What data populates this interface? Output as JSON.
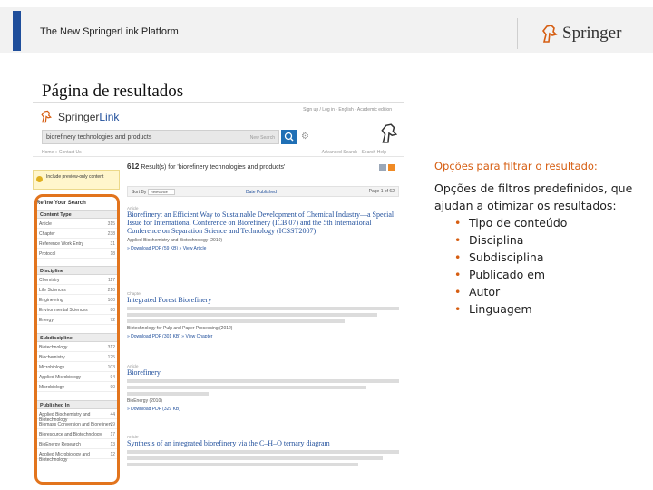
{
  "header": {
    "title": "The New SpringerLink Platform",
    "brand": "Springer",
    "accent_color": "#1f4e9b"
  },
  "page_heading": "Página de resultados",
  "screenshot": {
    "logo": {
      "part1": "Springer",
      "part2": "Link"
    },
    "search_query": "biorefinery technologies and products",
    "search_hint": "New Search",
    "top_links": "Sign up / Log in · English · Academic edition",
    "breadcrumb": "Home » Contact Us",
    "breadcrumb_right": "Advanced Search · Search Help",
    "include_banner": "Include preview-only content",
    "refine_title": "Refine Your Search",
    "results_count": "612",
    "results_text": "Result(s) for 'biorefinery technologies and products'",
    "sort_label": "Sort By",
    "sort_value": "Relevance",
    "date_published": "Date Published",
    "page_label": "Page  1  of 62",
    "facets": [
      {
        "title": "Content Type",
        "items": [
          {
            "label": "Article",
            "count": "315"
          },
          {
            "label": "Chapter",
            "count": "238"
          },
          {
            "label": "Reference Work Entry",
            "count": "31"
          },
          {
            "label": "Protocol",
            "count": "18"
          }
        ]
      },
      {
        "title": "Discipline",
        "items": [
          {
            "label": "Chemistry",
            "count": "117"
          },
          {
            "label": "Life Sciences",
            "count": "210"
          },
          {
            "label": "Engineering",
            "count": "100"
          },
          {
            "label": "Environmental Sciences",
            "count": "80"
          },
          {
            "label": "Energy",
            "count": "72"
          }
        ]
      },
      {
        "title": "Subdiscipline",
        "items": [
          {
            "label": "Biotechnology",
            "count": "312"
          },
          {
            "label": "Biochemistry",
            "count": "125"
          },
          {
            "label": "Microbiology",
            "count": "103"
          },
          {
            "label": "Applied Microbiology",
            "count": "94"
          },
          {
            "label": "Microbiology",
            "count": "90"
          }
        ]
      },
      {
        "title": "Published In",
        "items": [
          {
            "label": "Applied Biochemistry and Biotechnology",
            "count": "44"
          },
          {
            "label": "Biomass Conversion and Biorefinery",
            "count": "39"
          },
          {
            "label": "Bioresource and Biotechnology",
            "count": "17"
          },
          {
            "label": "BioEnergy Research",
            "count": "13"
          },
          {
            "label": "Applied Microbiology and Biotechnology",
            "count": "12"
          }
        ]
      }
    ],
    "results": [
      {
        "kind": "Article",
        "title": "Biorefinery: an Efficient Way to Sustainable Development of Chemical Industry—a Special Issue for International Conference on Biorefinery (ICB 07) and the 5th International Conference on Separation Science and Technology (ICSST2007)",
        "source": "Applied Biochemistry and Biotechnology (2010)",
        "download": "» Download PDF (59 KB) » View Article"
      },
      {
        "kind": "Chapter",
        "title": "Integrated Forest Biorefinery",
        "source": "Biotechnology for Pulp and Paper Processing (2012)",
        "download": "» Download PDF (301 KB) » View Chapter"
      },
      {
        "kind": "Article",
        "title": "Biorefinery",
        "source": "BioEnergy (2010)",
        "download": "» Download PDF (329 KB)"
      },
      {
        "kind": "Article",
        "title": "Synthesis of an integrated biorefinery via the C–H–O ternary diagram",
        "source": "",
        "download": ""
      }
    ]
  },
  "annotation": {
    "heading": "Opções para filtrar o resultado:",
    "body": "Opções de filtros predefinidos, que ajudan a otimizar os resultados:",
    "bullets": [
      "Tipo de conteúdo",
      "Disciplina",
      "Subdisciplina",
      "Publicado em",
      "Autor",
      "Linguagem"
    ],
    "highlight_color": "#e2741d"
  }
}
